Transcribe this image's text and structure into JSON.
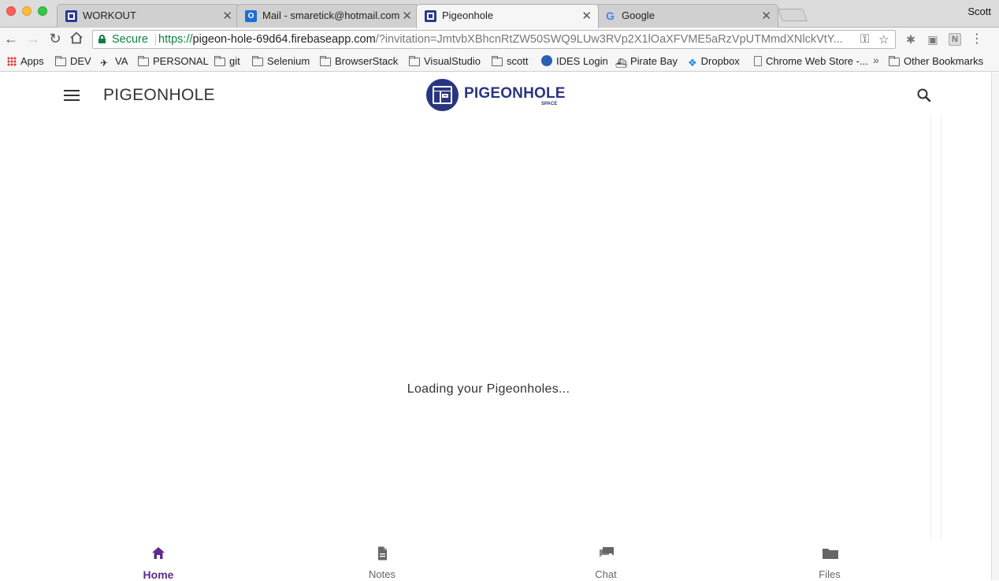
{
  "browser": {
    "tabs": [
      {
        "title": "WORKOUT",
        "favicon": "pigeonhole-grid-icon",
        "active": false
      },
      {
        "title": "Mail - smaretick@hotmail.com",
        "favicon": "outlook-icon",
        "active": false
      },
      {
        "title": "Pigeonhole",
        "favicon": "pigeonhole-grid-icon",
        "active": true
      },
      {
        "title": "Google",
        "favicon": "google-icon",
        "active": false
      }
    ],
    "profile_name": "Scott",
    "address": {
      "secure_label": "Secure",
      "scheme": "https://",
      "host": "pigeon-hole-69d64.firebaseapp.com",
      "path": "/?invitation=JmtvbXBhcnRtZW50SWQ9LUw3RVp2X1lOaXFVME5aRzVpUTMmdXNlckVtY..."
    },
    "bookmarks": [
      {
        "label": "Apps",
        "icon": "apps-grid-icon"
      },
      {
        "label": "DEV",
        "icon": "folder-icon"
      },
      {
        "label": "VA",
        "icon": "va-logo-icon"
      },
      {
        "label": "PERSONAL",
        "icon": "folder-icon"
      },
      {
        "label": "git",
        "icon": "folder-icon"
      },
      {
        "label": "Selenium",
        "icon": "folder-icon"
      },
      {
        "label": "BrowserStack",
        "icon": "folder-icon"
      },
      {
        "label": "VisualStudio",
        "icon": "folder-icon"
      },
      {
        "label": "scott",
        "icon": "folder-icon"
      },
      {
        "label": "IDES Login",
        "icon": "globe-icon"
      },
      {
        "label": "Pirate Bay",
        "icon": "ship-icon"
      },
      {
        "label": "Dropbox",
        "icon": "dropbox-icon"
      },
      {
        "label": "Chrome Web Store -...",
        "icon": "page-icon"
      },
      {
        "label": "Other Bookmarks",
        "icon": "folder-icon"
      }
    ]
  },
  "app": {
    "header_title": "PIGEONHOLE",
    "logo_text": "PIGEONHOLE",
    "logo_subtext": "SPACE",
    "loading_text": "Loading your Pigeonholes...",
    "accent_color": "#5c2d91",
    "brand_color": "#2a3580",
    "bottom_nav": [
      {
        "label": "Home",
        "icon": "home-icon",
        "active": true
      },
      {
        "label": "Notes",
        "icon": "notes-icon",
        "active": false
      },
      {
        "label": "Chat",
        "icon": "chat-icon",
        "active": false
      },
      {
        "label": "Files",
        "icon": "folder-icon",
        "active": false
      }
    ]
  }
}
